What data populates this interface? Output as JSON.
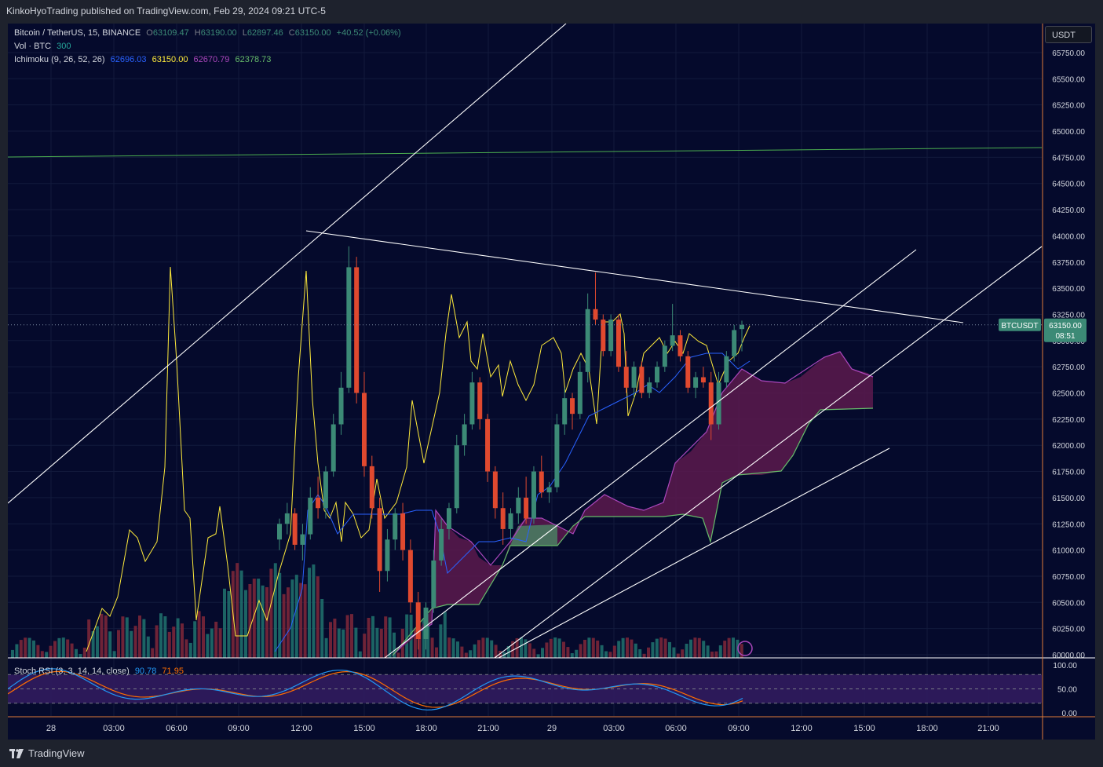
{
  "header": {
    "published": "KinkoHyoTrading published on TradingView.com, Feb 29, 2024 09:21 UTC-5"
  },
  "legend": {
    "symbol": "Bitcoin / TetherUS, 15, BINANCE",
    "o_label": "O",
    "o": "63109.47",
    "h_label": "H",
    "h": "63190.00",
    "l_label": "L",
    "l": "62897.46",
    "c_label": "C",
    "c": "63150.00",
    "change": "+40.52 (+0.06%)",
    "vol_label": "Vol · BTC",
    "vol": "300",
    "ichimoku_label": "Ichimoku (9, 26, 52, 26)",
    "ichimoku_values": [
      "62696.03",
      "63150.00",
      "62670.79",
      "62378.73"
    ],
    "stoch_label": "Stoch RSI (3, 3, 14, 14, close)",
    "stoch_k": "90.78",
    "stoch_d": "71.95"
  },
  "currency_button": "USDT",
  "price_tag": {
    "symbol": "BTCUSDT",
    "price": "63150.00",
    "countdown": "08:51"
  },
  "footer": {
    "brand": "TradingView"
  },
  "colors": {
    "background": "#050a2c",
    "up": "#3c8a76",
    "down": "#e0492f",
    "tenkan": "#2962ff",
    "kijun": "#ffeb3b",
    "span_b": "#9c27b0",
    "cloud_bull": "#4a7a60",
    "cloud_bear": "#5c1a4e",
    "green_line": "#4caf50",
    "stoch_k": "#2196f3",
    "stoch_d": "#ff6d00",
    "stoch_bg": "#311b5e"
  },
  "chart_data": {
    "type": "candlestick",
    "price_axis": {
      "ylim": [
        60000,
        65850
      ],
      "ticks": [
        "65750.00",
        "65500.00",
        "65250.00",
        "65000.00",
        "64750.00",
        "64500.00",
        "64250.00",
        "64000.00",
        "63750.00",
        "63500.00",
        "63250.00",
        "63000.00",
        "62750.00",
        "62500.00",
        "62250.00",
        "62000.00",
        "61750.00",
        "61500.00",
        "61250.00",
        "61000.00",
        "60750.00",
        "60500.00",
        "60250.00",
        "60000.00"
      ]
    },
    "time_axis": {
      "ticks": [
        "28",
        "03:00",
        "06:00",
        "09:00",
        "12:00",
        "15:00",
        "18:00",
        "21:00",
        "29",
        "03:00",
        "06:00",
        "09:00",
        "12:00",
        "15:00",
        "18:00",
        "21:00"
      ]
    },
    "candles": [
      [
        61100,
        61300,
        61000,
        61250
      ],
      [
        61250,
        61450,
        61150,
        61350
      ],
      [
        61350,
        61400,
        61000,
        61050
      ],
      [
        61050,
        61250,
        60900,
        61150
      ],
      [
        61150,
        61600,
        61100,
        61500
      ],
      [
        61500,
        61700,
        61300,
        61400
      ],
      [
        61400,
        61800,
        61300,
        61750
      ],
      [
        61750,
        62300,
        61700,
        62200
      ],
      [
        62200,
        62700,
        62100,
        62550
      ],
      [
        62550,
        63900,
        62500,
        63700
      ],
      [
        63700,
        63800,
        62400,
        62500
      ],
      [
        62500,
        62700,
        61700,
        61800
      ],
      [
        61800,
        61900,
        61300,
        61400
      ],
      [
        61400,
        61500,
        60600,
        60800
      ],
      [
        60800,
        61200,
        60700,
        61100
      ],
      [
        61100,
        61400,
        61000,
        61350
      ],
      [
        61350,
        61450,
        60900,
        61000
      ],
      [
        61000,
        61100,
        60400,
        60500
      ],
      [
        60500,
        60600,
        60050,
        60150
      ],
      [
        60150,
        60500,
        60050,
        60450
      ],
      [
        60450,
        61000,
        60400,
        60900
      ],
      [
        60900,
        61300,
        60850,
        61200
      ],
      [
        61200,
        61450,
        61100,
        61400
      ],
      [
        61400,
        62100,
        61350,
        62000
      ],
      [
        62000,
        62300,
        61900,
        62200
      ],
      [
        62200,
        62700,
        62150,
        62600
      ],
      [
        62600,
        62650,
        62150,
        62250
      ],
      [
        62250,
        62300,
        61650,
        61750
      ],
      [
        61750,
        61800,
        61300,
        61400
      ],
      [
        61400,
        61550,
        61050,
        61200
      ],
      [
        61200,
        61400,
        61100,
        61350
      ],
      [
        61350,
        61600,
        61250,
        61500
      ],
      [
        61500,
        61700,
        61250,
        61300
      ],
      [
        61300,
        61800,
        61250,
        61750
      ],
      [
        61750,
        61900,
        61500,
        61550
      ],
      [
        61550,
        61650,
        61450,
        61600
      ],
      [
        61600,
        62300,
        61550,
        62200
      ],
      [
        62200,
        62550,
        62100,
        62450
      ],
      [
        62450,
        62500,
        62150,
        62300
      ],
      [
        62300,
        62800,
        62250,
        62700
      ],
      [
        62700,
        63450,
        62600,
        63300
      ],
      [
        63300,
        63650,
        63150,
        63200
      ],
      [
        63200,
        63250,
        62850,
        62900
      ],
      [
        62900,
        63250,
        62850,
        63200
      ],
      [
        63200,
        63250,
        62700,
        62750
      ],
      [
        62750,
        62900,
        62500,
        62550
      ],
      [
        62550,
        62800,
        62450,
        62750
      ],
      [
        62750,
        62800,
        62450,
        62500
      ],
      [
        62500,
        62650,
        62450,
        62600
      ],
      [
        62600,
        62800,
        62550,
        62750
      ],
      [
        62750,
        63000,
        62700,
        62950
      ],
      [
        62950,
        63350,
        62900,
        63050
      ],
      [
        63050,
        63100,
        62800,
        62850
      ],
      [
        62850,
        62900,
        62500,
        62550
      ],
      [
        62550,
        62700,
        62450,
        62650
      ],
      [
        62650,
        62750,
        62550,
        62600
      ],
      [
        62600,
        62700,
        62050,
        62200
      ],
      [
        62200,
        62700,
        62150,
        62600
      ],
      [
        62600,
        62900,
        62550,
        62850
      ],
      [
        62850,
        63150,
        62800,
        63100
      ],
      [
        63109.47,
        63190,
        62897.46,
        63150
      ]
    ],
    "stoch_axis": {
      "ylim": [
        0,
        100
      ],
      "ticks": [
        "100.00",
        "50.00",
        "0.00"
      ]
    },
    "annotations": [
      "ascending channel",
      "descending resistance line",
      "horizontal level near 64770"
    ]
  }
}
